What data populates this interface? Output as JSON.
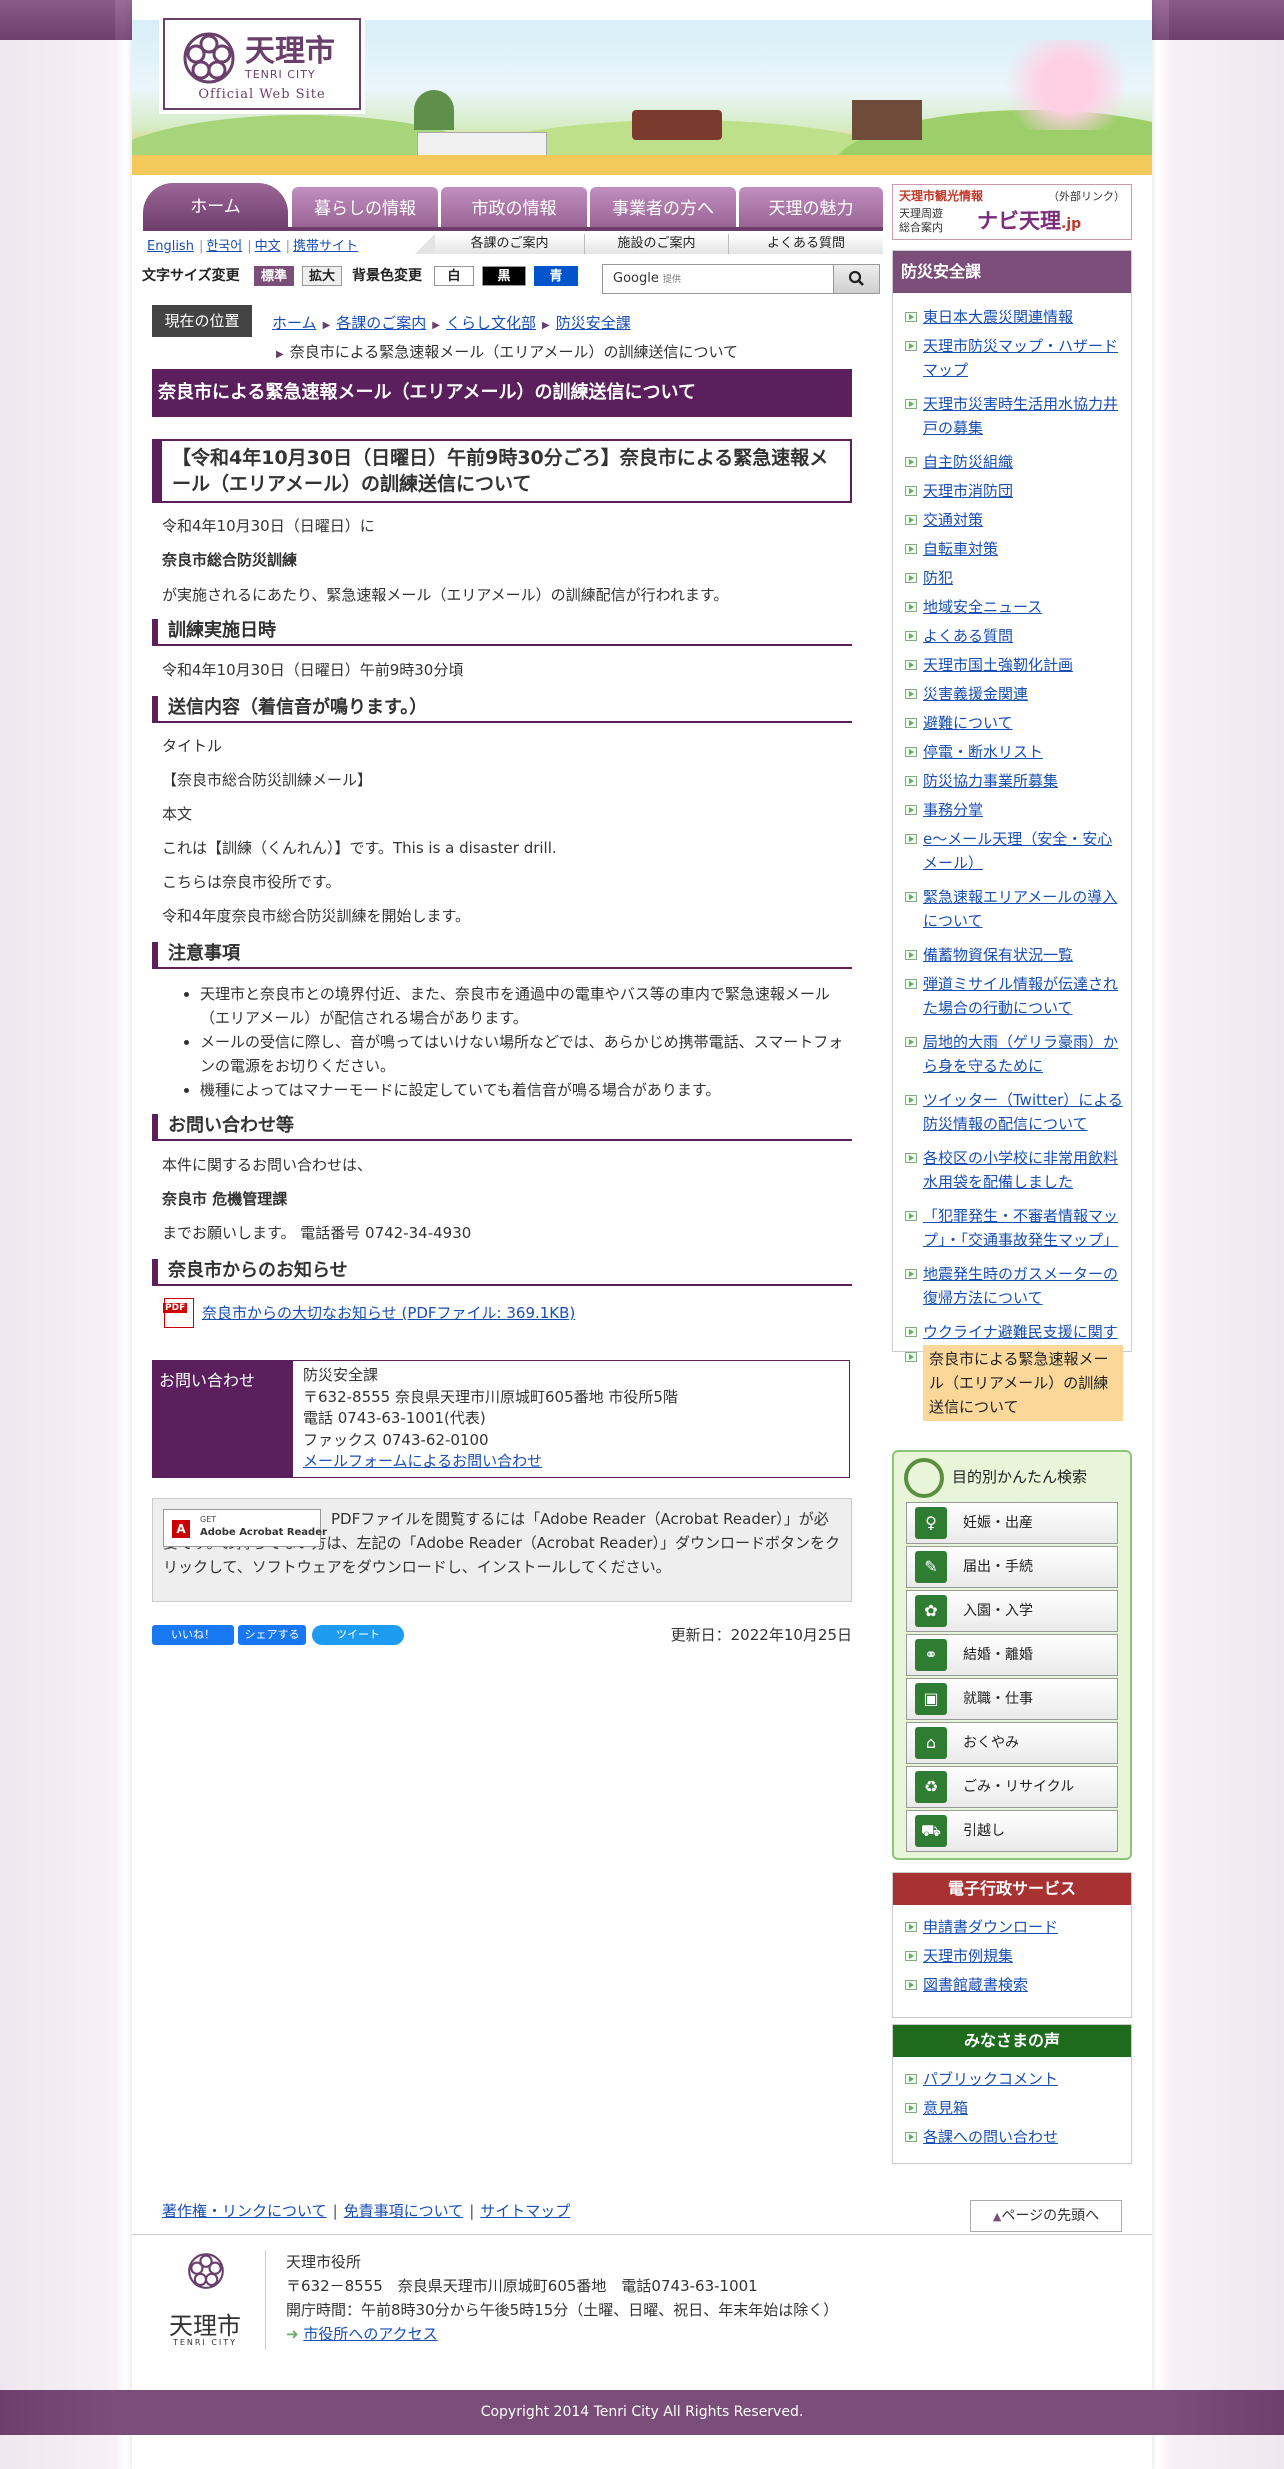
{
  "header": {
    "logo_jp": "天理市",
    "logo_en": "TENRI CITY",
    "logo_sub": "Official Web Site"
  },
  "gnav": [
    "ホーム",
    "暮らしの情報",
    "市政の情報",
    "事業者の方へ",
    "天理の魅力"
  ],
  "langs": [
    "English",
    "한국어",
    "中文",
    "携帯サイト"
  ],
  "subnav": [
    "各課のご案内",
    "施設のご案内",
    "よくある質問"
  ],
  "tools": {
    "font_label": "文字サイズ変更",
    "std": "標準",
    "big": "拡大",
    "color_label": "背景色変更",
    "white": "白",
    "black": "黒",
    "blue": "青",
    "search_brand": "Google",
    "search_small": "提供"
  },
  "breadcrumb": {
    "here": "現在の位置",
    "items": [
      "ホーム",
      "各課のご案内",
      "くらし文化部",
      "防災安全課"
    ],
    "current": "奈良市による緊急速報メール（エリアメール）の訓練送信について"
  },
  "main": {
    "title": "奈良市による緊急速報メール（エリアメール）の訓練送信について",
    "h2": "【令和4年10月30日（日曜日）午前9時30分ごろ】奈良市による緊急速報メール（エリアメール）の訓練送信について",
    "intro1": "令和4年10月30日（日曜日）に",
    "intro2": "奈良市総合防災訓練",
    "intro3": "が実施されるにあたり、緊急速報メール（エリアメール）の訓練配信が行われます。",
    "h3_date": "訓練実施日時",
    "date": "令和4年10月30日（日曜日）午前9時30分頃",
    "h3_content": "送信内容（着信音が鳴ります。）",
    "c_title_label": "タイトル",
    "c_title": "【奈良市総合防災訓練メール】",
    "c_body_label": "本文",
    "c_body1": "これは【訓練（くんれん）】です。This is a disaster drill.",
    "c_body2": "こちらは奈良市役所です。",
    "c_body3": "令和4年度奈良市総合防災訓練を開始します。",
    "h3_notes": "注意事項",
    "notes": [
      "天理市と奈良市との境界付近、また、奈良市を通過中の電車やバス等の車内で緊急速報メール（エリアメール）が配信される場合があります。",
      "メールの受信に際し、音が鳴ってはいけない場所などでは、あらかじめ携帯電話、スマートフォンの電源をお切りください。",
      "機種によってはマナーモードに設定していても着信音が鳴る場合があります。"
    ],
    "h3_inquiry": "お問い合わせ等",
    "inq1": "本件に関するお問い合わせは、",
    "inq2": "奈良市 危機管理課",
    "inq3": "までお願いします。 電話番号 0742-34-4930",
    "h3_news": "奈良市からのお知らせ",
    "pdf_badge": "PDF",
    "pdf_link": "奈良市からの大切なお知らせ (PDFファイル: 369.1KB)"
  },
  "contact": {
    "label": "お問い合わせ",
    "dept": "防災安全課",
    "address": "〒632-8555 奈良県天理市川原城町605番地 市役所5階",
    "tel": "電話 0743-63-1001(代表)",
    "fax": "ファックス 0743-62-0100",
    "form": "メールフォームによるお問い合わせ"
  },
  "adobe": {
    "get": "GET",
    "brand": "Adobe Acrobat Reader",
    "text": "PDFファイルを閲覧するには「Adobe Reader（Acrobat Reader）」が必要です。お持ちでない方は、左記の「Adobe Reader（Acrobat Reader）」ダウンロードボタンをクリックして、ソフトウェアをダウンロードし、インストールしてください。"
  },
  "social": {
    "like": "いいね！",
    "share": "シェアする",
    "tweet": "ツイート"
  },
  "updated": "更新日：2022年10月25日",
  "tour": {
    "label": "天理市観光情報",
    "ext": "（外部リンク）",
    "sub1": "天理周遊",
    "sub2": "総合案内",
    "brand": "ナビ天理",
    "dot": ".jp"
  },
  "side": {
    "title": "防災安全課",
    "items": [
      "東日本大震災関連情報",
      "天理市防災マップ・ハザードマップ",
      "天理市災害時生活用水協力井戸の募集",
      "自主防災組織",
      "天理市消防団",
      "交通対策",
      "自転車対策",
      "防犯",
      "地域安全ニュース",
      "よくある質問",
      "天理市国土強靭化計画",
      "災害義援金関連",
      "避難について",
      "停電・断水リスト",
      "防災協力事業所募集",
      "事務分掌",
      "e～メール天理（安全・安心メール）",
      "緊急速報エリアメールの導入について",
      "備蓄物資保有状況一覧",
      "弾道ミサイル情報が伝達された場合の行動について",
      "局地的大雨（ゲリラ豪雨）から身を守るために",
      "ツイッター（Twitter）による防災情報の配信について",
      "各校区の小学校に非常用飲料水用袋を配備しました",
      "「犯罪発生・不審者情報マップ」・「交通事故発生マップ」",
      "地震発生時のガスメーターの復帰方法について",
      "ウクライナ避難民支援に関する募金箱を設置します"
    ],
    "current": "奈良市による緊急速報メール（エリアメール）の訓練送信について"
  },
  "purpose": {
    "title": "目的別かんたん検索",
    "items": [
      "妊娠・出産",
      "届出・手続",
      "入園・入学",
      "結婚・離婚",
      "就職・仕事",
      "おくやみ",
      "ごみ・リサイクル",
      "引越し"
    ]
  },
  "egov": {
    "title": "電子行政サービス",
    "items": [
      "申請書ダウンロード",
      "天理市例規集",
      "図書館蔵書検索"
    ]
  },
  "voice": {
    "title": "みなさまの声",
    "items": [
      "パブリックコメント",
      "意見箱",
      "各課への問い合わせ"
    ]
  },
  "footer": {
    "links": [
      "著作権・リンクについて",
      "免責事項について",
      "サイトマップ"
    ],
    "totop": "ページの先頭へ",
    "name": "天理市役所",
    "address": "〒632－8555　奈良県天理市川原城町605番地　電話0743-63-1001",
    "hours": "開庁時間：午前8時30分から午後5時15分（土曜、日曜、祝日、年末年始は除く）",
    "access": "市役所へのアクセス",
    "logo_jp": "天理市",
    "logo_en": "TENRI CITY",
    "copyright": "Copyright 2014 Tenri City All Rights Reserved."
  },
  "colors": {
    "accent": "#5b1f5d",
    "nav": "#94608f",
    "egov": "#a83232",
    "voice": "#1e6b1e"
  }
}
